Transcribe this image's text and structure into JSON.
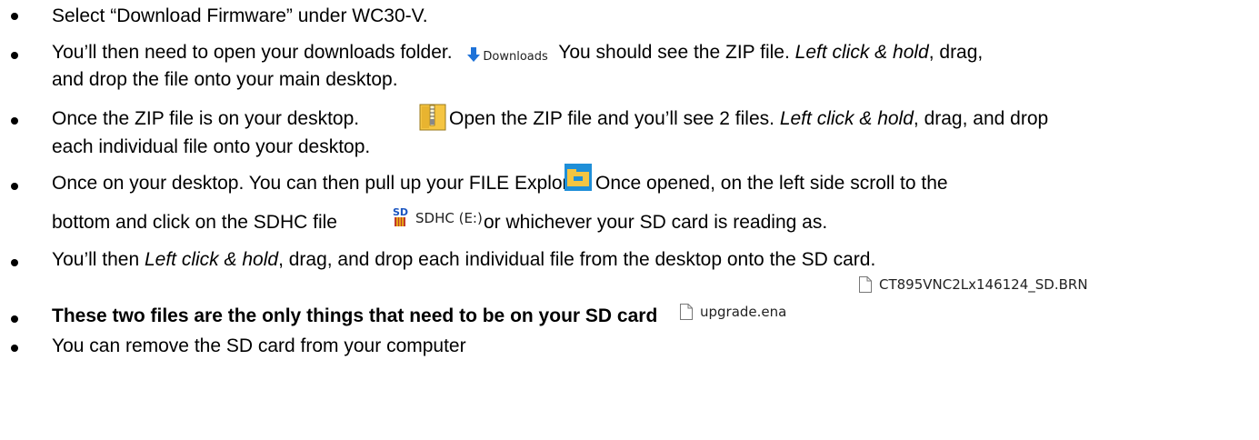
{
  "instructions": {
    "b1": "Select “Download Firmware” under WC30-V.",
    "b2": {
      "a": "You’ll then need to open your downloads folder.",
      "icon_label": "Downloads",
      "b": "You should see the ZIP file.",
      "c": "Left click & hold",
      "d": ", drag,",
      "e": "and drop the file onto your main desktop."
    },
    "b3": {
      "a": "Once the ZIP file is on your desktop.",
      "b": "Open the ZIP file and you’ll see 2 files.",
      "c": "Left click & hold",
      "d": ", drag, and drop",
      "e": "each individual file onto your desktop."
    },
    "b4": {
      "a": "Once on your desktop. You can then pull up your FILE Explorer",
      "b": "Once opened, on the left side scroll to the",
      "c": "bottom and click on the SDHC file",
      "sd_label": "SDHC (E:)",
      "d": "or whichever your SD card is reading as."
    },
    "b5": {
      "a": "You’ll then",
      "b": "Left click & hold",
      "c": ", drag, and drop each individual file from the desktop onto the SD card."
    },
    "file1": "CT895VNC2Lx146124_SD.BRN",
    "b6": "These two files are the only things that need to be on your SD card",
    "file2": "upgrade.ena",
    "b7": "You can remove the SD card from your computer"
  },
  "icons": {
    "downloads": "download-arrow-icon",
    "zip": "zip-folder-icon",
    "explorer": "file-explorer-icon",
    "sd": "sd-card-icon",
    "file": "file-icon"
  },
  "colors": {
    "download_arrow": "#1e72d8",
    "zip_folder": "#f5c542",
    "explorer_blue": "#1f8fd8",
    "explorer_yellow": "#f4c542",
    "sd_red": "#c0392b"
  }
}
